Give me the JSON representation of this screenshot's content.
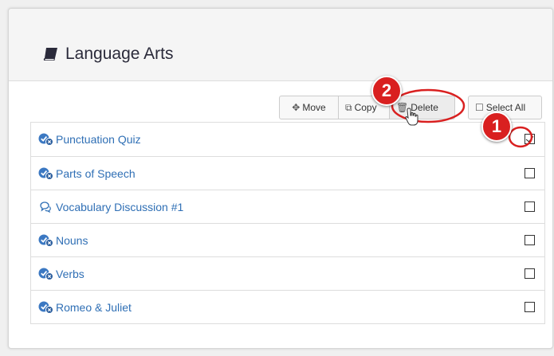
{
  "panel": {
    "title": "Language Arts",
    "title_icon": "book-icon"
  },
  "toolbar": {
    "move_label": "Move",
    "copy_label": "Copy",
    "delete_label": "Delete",
    "select_all_label": "Select All"
  },
  "items": [
    {
      "label": "Punctuation Quiz",
      "icon": "check-badge-icon",
      "checked": true
    },
    {
      "label": "Parts of Speech",
      "icon": "check-badge-icon",
      "checked": false
    },
    {
      "label": "Vocabulary Discussion #1",
      "icon": "discussion-icon",
      "checked": false
    },
    {
      "label": "Nouns",
      "icon": "check-badge-icon",
      "checked": false
    },
    {
      "label": "Verbs",
      "icon": "check-badge-icon",
      "checked": false
    },
    {
      "label": "Romeo & Juliet",
      "icon": "check-badge-icon",
      "checked": false
    }
  ],
  "callouts": {
    "step1": "1",
    "step2": "2"
  },
  "colors": {
    "link": "#2f6fb5",
    "icon_blue": "#3b78c2",
    "callout_red": "#d92020"
  }
}
